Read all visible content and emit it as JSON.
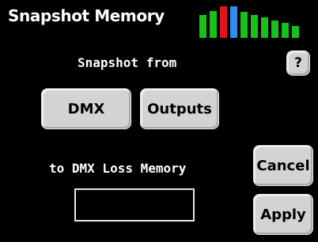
{
  "header": {
    "title": "Snapshot Memory"
  },
  "meter": {
    "bars": [
      {
        "color": "#19c21b",
        "level": 0.72
      },
      {
        "color": "#19c21b",
        "level": 0.85
      },
      {
        "color": "#e4141c",
        "level": 1.0
      },
      {
        "color": "#2f8df0",
        "level": 1.0
      },
      {
        "color": "#19c21b",
        "level": 0.82
      },
      {
        "color": "#19c21b",
        "level": 0.72
      },
      {
        "color": "#19c21b",
        "level": 0.65
      },
      {
        "color": "#19c21b",
        "level": 0.55
      },
      {
        "color": "#19c21b",
        "level": 0.48
      },
      {
        "color": "#19c21b",
        "level": 0.38
      }
    ]
  },
  "main": {
    "snapshot_from_label": "Snapshot from",
    "dmx_button": "DMX",
    "outputs_button": "Outputs",
    "target_label": "to DMX Loss Memory",
    "target_value": ""
  },
  "side": {
    "help_button": "?",
    "cancel_button": "Cancel",
    "apply_button": "Apply"
  }
}
